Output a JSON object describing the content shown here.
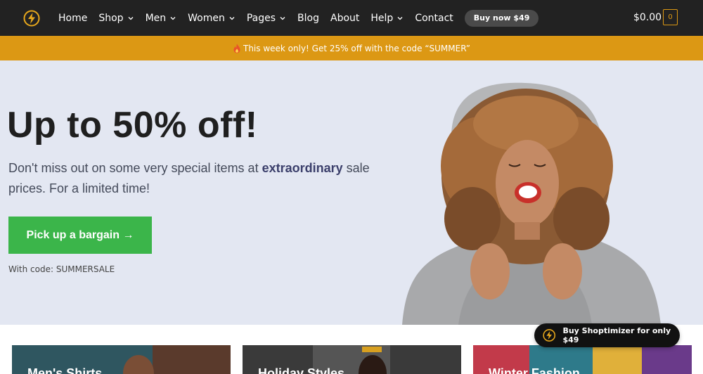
{
  "nav": {
    "logo_icon": "lightning-icon",
    "items": [
      {
        "label": "Home",
        "has_dropdown": false
      },
      {
        "label": "Shop",
        "has_dropdown": true
      },
      {
        "label": "Men",
        "has_dropdown": true
      },
      {
        "label": "Women",
        "has_dropdown": true
      },
      {
        "label": "Pages",
        "has_dropdown": true
      },
      {
        "label": "Blog",
        "has_dropdown": false
      },
      {
        "label": "About",
        "has_dropdown": false
      },
      {
        "label": "Help",
        "has_dropdown": true
      },
      {
        "label": "Contact",
        "has_dropdown": false
      }
    ],
    "buy_label": "Buy now $49",
    "cart_total": "$0.00",
    "cart_count": "0"
  },
  "promo": {
    "text": "This week only! Get 25% off with the code “SUMMER”",
    "icon": "flame-icon"
  },
  "hero": {
    "title": "Up to 50% off!",
    "subtitle_start": "Don't miss out on some very special items at ",
    "subtitle_bold": "extraordinary",
    "subtitle_end": " sale prices. For a limited time!",
    "cta_label": "Pick up a bargain →",
    "code_note": "With code: SUMMERSALE",
    "photo": "laughing-woman-curly-hair-photo"
  },
  "cards": [
    {
      "title": "Men's Shirts"
    },
    {
      "title": "Holiday Styles"
    },
    {
      "title": "Winter Fashion"
    }
  ],
  "floating_buy": {
    "label": "Buy Shoptimizer for only $49",
    "icon": "lightning-icon"
  },
  "colors": {
    "nav_bg": "#222222",
    "promo_bg": "#dc9814",
    "hero_bg": "#e3e7f2",
    "cta_bg": "#3bb54a",
    "accent": "#dc9814"
  }
}
